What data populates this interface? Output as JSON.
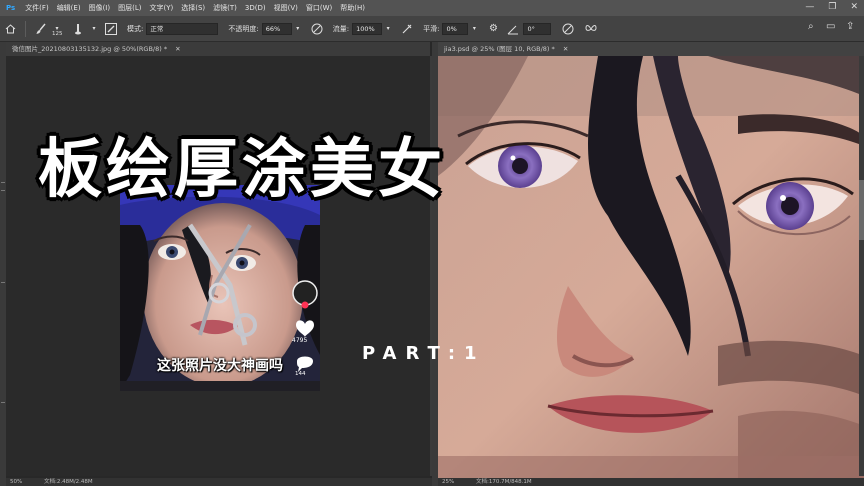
{
  "menu": [
    "文件(F)",
    "编辑(E)",
    "图像(I)",
    "图层(L)",
    "文字(Y)",
    "选择(S)",
    "滤镜(T)",
    "3D(D)",
    "视图(V)",
    "窗口(W)",
    "帮助(H)"
  ],
  "options": {
    "brush_size": "125",
    "mode_label": "模式:",
    "mode_value": "正常",
    "opacity_label": "不透明度:",
    "opacity_value": "66%",
    "flow_label": "流量:",
    "flow_value": "100%",
    "smooth_label": "平滑:",
    "smooth_value": "0%",
    "angle_value": "0°"
  },
  "tabs": {
    "left": "微信图片_20210803135132.jpg @ 50%(RGB/8) *",
    "right": "jia3.psd @ 25% (图层 10, RGB/8) *"
  },
  "status": {
    "left_zoom": "50%",
    "left_doc": "文档:2.48M/2.48M",
    "right_zoom": "25%",
    "right_doc": "文档:170.7M/848.1M"
  },
  "photo": {
    "caption": "这张照片没大神画吗",
    "likes": "4795",
    "comments": "144"
  },
  "overlay": {
    "title": "板绘厚涂美女",
    "part": "PART:1"
  },
  "colors": {
    "menubar": "#535353",
    "optbar": "#434343",
    "canvas_bg": "#282828",
    "skin": "#c9978a",
    "iris": "#8a6fc0"
  }
}
